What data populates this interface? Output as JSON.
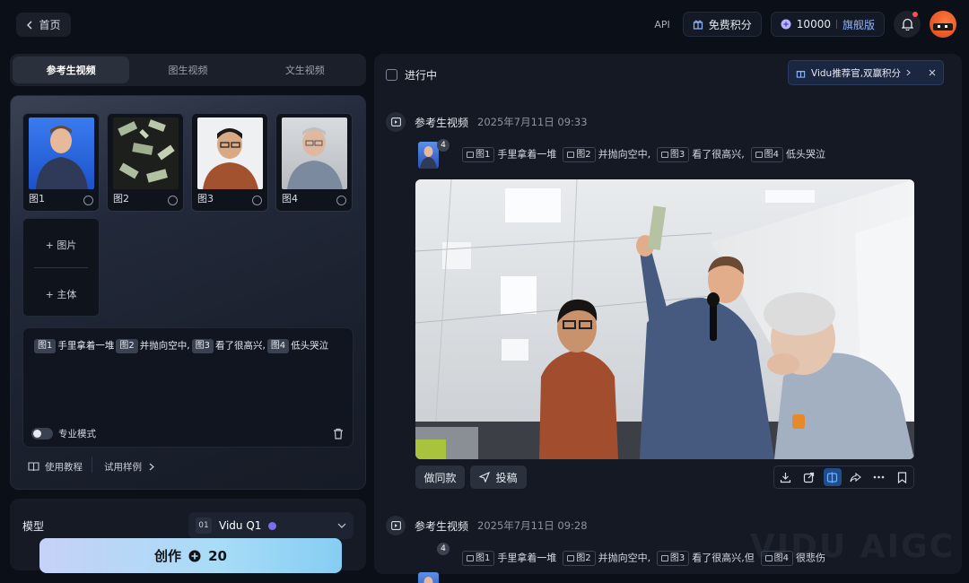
{
  "header": {
    "home_label": "首页",
    "api_label": "API",
    "free_credits_label": "免费积分",
    "credits_value": "10000",
    "plan_label": "旗舰版"
  },
  "tabs": [
    {
      "label": "参考生视频"
    },
    {
      "label": "图生视频"
    },
    {
      "label": "文生视频"
    }
  ],
  "references": [
    {
      "label": "图1"
    },
    {
      "label": "图2"
    },
    {
      "label": "图3"
    },
    {
      "label": "图4"
    }
  ],
  "add": {
    "image_label": "图片",
    "subject_label": "主体"
  },
  "prompt": {
    "tags": [
      "图1",
      "图2",
      "图3",
      "图4"
    ],
    "seg1": "手里拿着一堆",
    "seg2": "并抛向空中,",
    "seg3": "看了很高兴,",
    "seg4": "低头哭泣"
  },
  "pro_mode_label": "专业模式",
  "links": {
    "tutorial_label": "使用教程",
    "samples_label": "试用样例"
  },
  "model": {
    "label": "模型",
    "value": "Vidu Q1",
    "icon_text": "01"
  },
  "create": {
    "label": "创作",
    "cost": "20"
  },
  "right": {
    "filter_label": "进行中",
    "promo_label": "Vidu推荐官,双赢积分",
    "tasks": [
      {
        "type": "参考生视频",
        "time": "2025年7月11日 09:33",
        "count": "4",
        "tags": [
          "图1",
          "图2",
          "图3",
          "图4"
        ],
        "seg1": "手里拿着一堆",
        "seg2": "并抛向空中,",
        "seg3": "看了很高兴,",
        "seg4": "低头哭泣"
      },
      {
        "type": "参考生视频",
        "time": "2025年7月11日 09:28",
        "count": "4",
        "tags": [
          "图1",
          "图2",
          "图3",
          "图4"
        ],
        "seg1": "手里拿着一堆",
        "seg2": "并抛向空中,",
        "seg3": "看了很高兴,但",
        "seg4": "很悲伤"
      }
    ],
    "same_style_label": "做同款",
    "submit_label": "投稿",
    "watermark": "VIDU AIGC"
  },
  "colors": {
    "accent": "#2b8cff",
    "create_gradient_start": "#c6d2f7",
    "create_gradient_end": "#86cdf3"
  }
}
